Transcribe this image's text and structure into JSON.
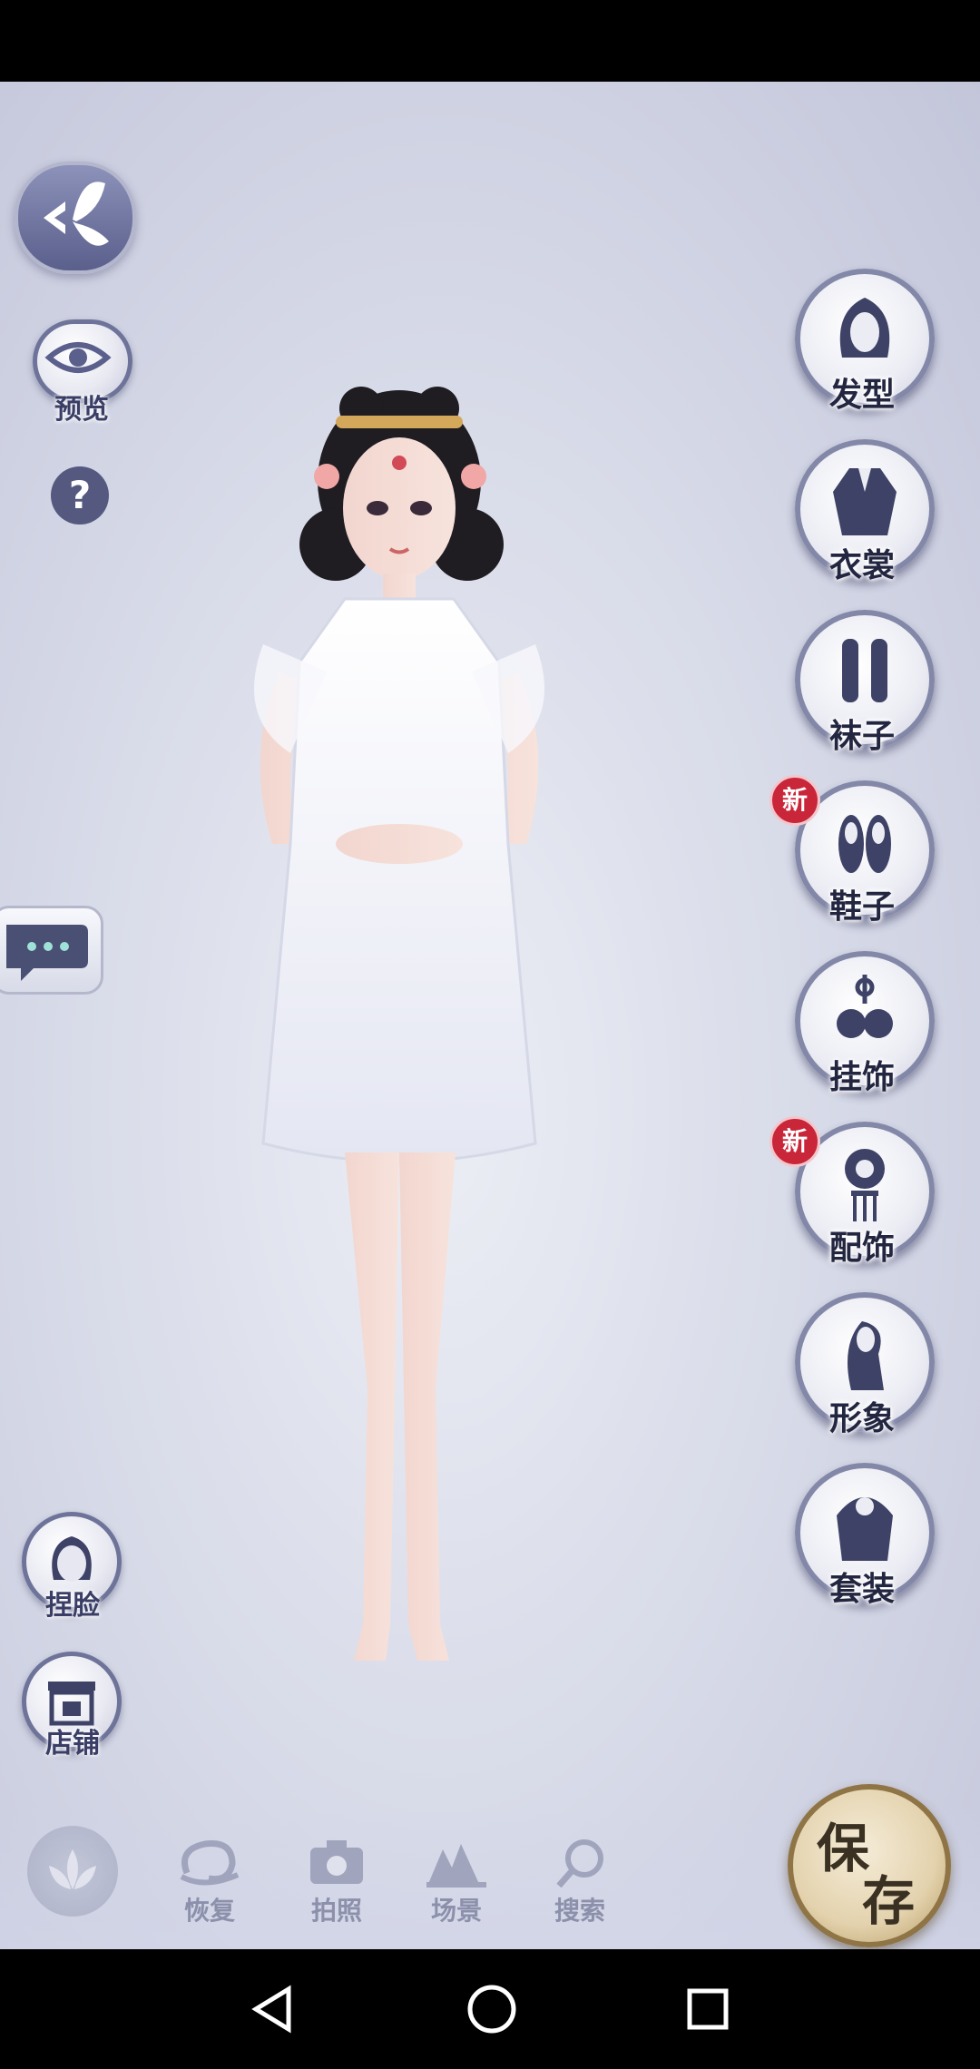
{
  "left_controls": {
    "preview_label": "预览",
    "help_glyph": "?",
    "face_label": "捏脸",
    "shop_label": "店铺"
  },
  "categories": [
    {
      "label": "发型",
      "icon": "hairstyle-icon",
      "new": false
    },
    {
      "label": "衣裳",
      "icon": "clothes-icon",
      "new": false
    },
    {
      "label": "袜子",
      "icon": "socks-icon",
      "new": false
    },
    {
      "label": "鞋子",
      "icon": "shoes-icon",
      "new": true
    },
    {
      "label": "挂饰",
      "icon": "pendant-icon",
      "new": false
    },
    {
      "label": "配饰",
      "icon": "accessory-icon",
      "new": true
    },
    {
      "label": "形象",
      "icon": "image-icon",
      "new": false
    },
    {
      "label": "套装",
      "icon": "outfit-set-icon",
      "new": false
    }
  ],
  "new_badge": "新",
  "toolbar": {
    "restore_label": "恢复",
    "photo_label": "拍照",
    "scene_label": "场景",
    "search_label": "搜索",
    "save_char1": "保",
    "save_char2": "存"
  },
  "colors": {
    "accent_dark": "#55597f",
    "badge_red": "#c9263a",
    "save_gold": "#e3d2ad"
  }
}
